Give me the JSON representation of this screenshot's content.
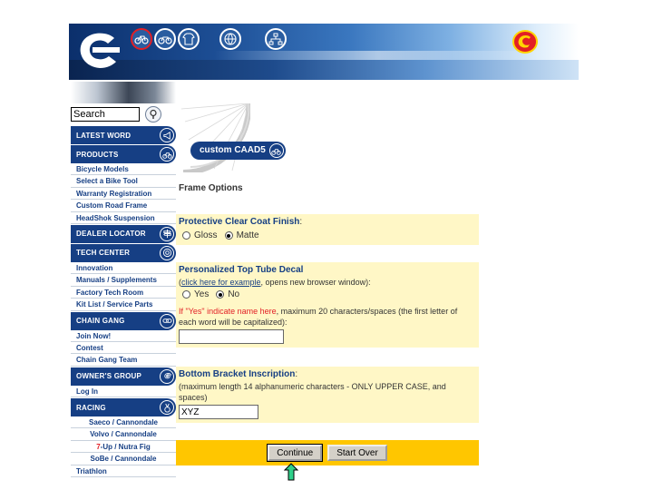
{
  "colors": {
    "navy": "#163f84",
    "yellow_panel": "#fff7c6",
    "gold_bar": "#ffc600",
    "red": "#e21f26"
  },
  "banner": {
    "nav_icons": [
      {
        "name": "road-bike-icon",
        "active": true
      },
      {
        "name": "mountain-bike-icon",
        "active": false
      },
      {
        "name": "jersey-icon",
        "active": false
      },
      {
        "name": "globe-icon",
        "active": false
      },
      {
        "name": "sitemap-icon",
        "active": false
      }
    ]
  },
  "sidebar": {
    "search_value": "Search",
    "sections": [
      {
        "label": "LATEST WORD",
        "icon": "megaphone-icon",
        "items": []
      },
      {
        "label": "PRODUCTS",
        "icon": "bike-icon",
        "items": [
          "Bicycle Models",
          "Select a Bike Tool",
          "Warranty Registration",
          "Custom Road Frame",
          "HeadShok Suspension"
        ]
      },
      {
        "label": "DEALER LOCATOR",
        "icon": "signpost-icon",
        "items": []
      },
      {
        "label": "TECH CENTER",
        "icon": "target-icon",
        "items": [
          "Innovation",
          "Manuals / Supplements",
          "Factory Tech Room",
          "Kit List / Service Parts"
        ]
      },
      {
        "label": "CHAIN GANG",
        "icon": "chain-icon",
        "items": [
          "Join Now!",
          "Contest",
          "Chain Gang Team"
        ]
      },
      {
        "label": "OWNER'S GROUP",
        "icon": "spiral-icon",
        "items": [
          "Log In"
        ]
      },
      {
        "label": "RACING",
        "icon": "medal-icon",
        "items": [
          "Saeco / Cannondale",
          "Volvo / Cannondale",
          "7-Up / Nutra Fig",
          "SoBe / Cannondale",
          "Triathlon"
        ]
      }
    ]
  },
  "header": {
    "badge": "custom CAAD5"
  },
  "page_title": "Frame Options",
  "clear_coat": {
    "title": "Protective Clear Coat Finish",
    "title_tail": ":",
    "options": [
      {
        "label": "Gloss",
        "selected": false
      },
      {
        "label": "Matte",
        "selected": true
      }
    ]
  },
  "decal": {
    "title": "Personalized Top Tube Decal",
    "paren_open": "(",
    "link": "click here for example",
    "link_tail": ", opens new browser window):",
    "options": [
      {
        "label": "Yes",
        "selected": false
      },
      {
        "label": "No",
        "selected": true
      }
    ],
    "instruction_red": "If \"Yes\" indicate name here",
    "instruction_rest": ", maximum 20 characters/spaces (the first letter of each word will be capitalized):",
    "value": ""
  },
  "bottom_bracket": {
    "title": "Bottom Bracket Inscription",
    "title_tail": ":",
    "note": "(maximum length 14 alphanumeric characters - ONLY UPPER CASE, and spaces)",
    "value": "XYZ"
  },
  "buttons": {
    "continue": "Continue",
    "start_over": "Start Over"
  }
}
